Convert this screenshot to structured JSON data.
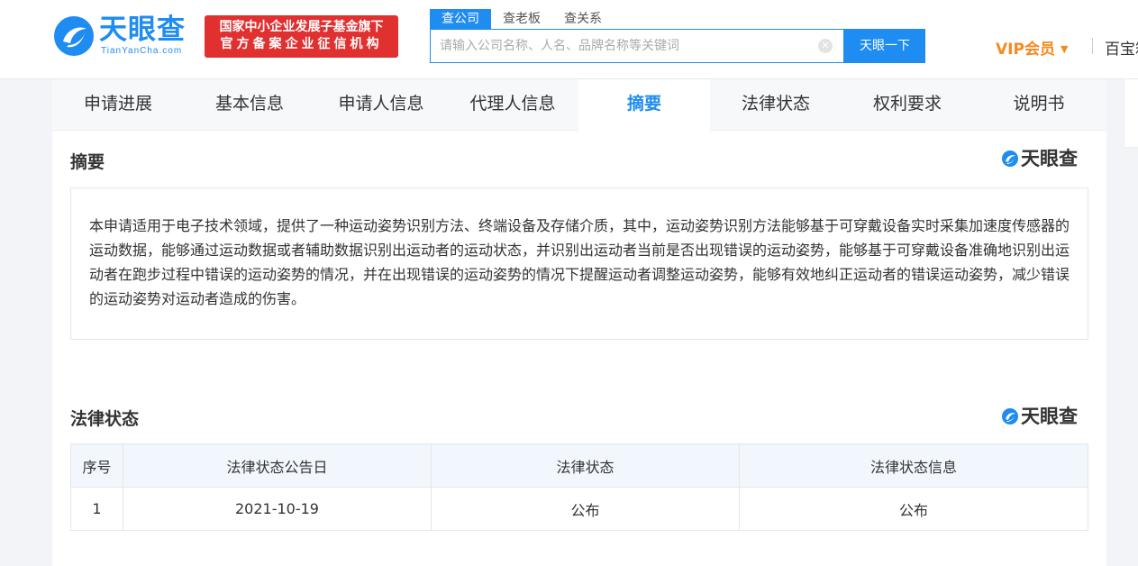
{
  "header": {
    "logo_text": "天眼查",
    "logo_sub": "TianYanCha.com",
    "badge_line1": "国家中小企业发展子基金旗下",
    "badge_line2": "官方备案企业征信机构",
    "search_tabs": [
      "查公司",
      "查老板",
      "查关系"
    ],
    "search_placeholder": "请输入公司名称、人名、品牌名称等关键词",
    "search_button": "天眼一下",
    "vip_label": "VIP会员",
    "baibao_label": "百宝箱"
  },
  "tabs": [
    "申请进展",
    "基本信息",
    "申请人信息",
    "代理人信息",
    "摘要",
    "法律状态",
    "权利要求",
    "说明书"
  ],
  "abstract": {
    "title": "摘要",
    "brand": "天眼查",
    "text": "本申请适用于电子技术领域，提供了一种运动姿势识别方法、终端设备及存储介质，其中，运动姿势识别方法能够基于可穿戴设备实时采集加速度传感器的运动数据，能够通过运动数据或者辅助数据识别出运动者的运动状态，并识别出运动者当前是否出现错误的运动姿势，能够基于可穿戴设备准确地识别出运动者在跑步过程中错误的运动姿势的情况，并在出现错误的运动姿势的情况下提醒运动者调整运动姿势，能够有效地纠正运动者的错误运动姿势，减少错误的运动姿势对运动者造成的伤害。"
  },
  "legal": {
    "title": "法律状态",
    "brand": "天眼查",
    "headers": [
      "序号",
      "法律状态公告日",
      "法律状态",
      "法律状态信息"
    ],
    "rows": [
      [
        "1",
        "2021-10-19",
        "公布",
        "公布"
      ]
    ]
  },
  "colors": {
    "brand_blue": "#1e8cf0",
    "badge_red": "#e0302f",
    "vip_orange": "#f58a1f"
  }
}
